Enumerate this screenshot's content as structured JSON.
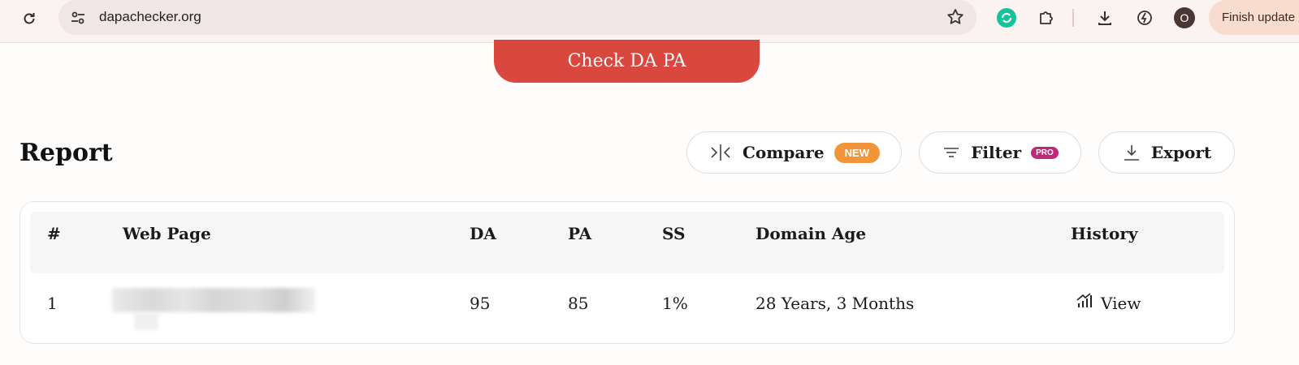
{
  "browser": {
    "url": "dapachecker.org",
    "profile_initial": "O",
    "update_button": "Finish update"
  },
  "page": {
    "check_button": "Check DA PA",
    "report_title": "Report",
    "actions": {
      "compare_label": "Compare",
      "compare_badge": "NEW",
      "filter_label": "Filter",
      "filter_badge": "PRO",
      "export_label": "Export"
    },
    "table": {
      "headers": {
        "num": "#",
        "web_page": "Web Page",
        "da": "DA",
        "pa": "PA",
        "ss": "SS",
        "domain_age": "Domain Age",
        "history": "History"
      },
      "rows": [
        {
          "num": "1",
          "web_page": "",
          "da": "95",
          "pa": "85",
          "ss": "1%",
          "domain_age": "28 Years, 3 Months",
          "history_link": "View"
        }
      ]
    }
  },
  "colors": {
    "primary_button": "#d9473f",
    "new_badge": "#f2953a",
    "pro_badge": "#c0287a",
    "grammarly": "#15c39a"
  },
  "icons": [
    "reload-icon",
    "site-settings-icon",
    "bookmark-star-icon",
    "grammarly-extension-icon",
    "extensions-puzzle-icon",
    "download-icon",
    "performance-icon",
    "compare-icon",
    "filter-icon",
    "export-icon",
    "history-chart-icon"
  ]
}
